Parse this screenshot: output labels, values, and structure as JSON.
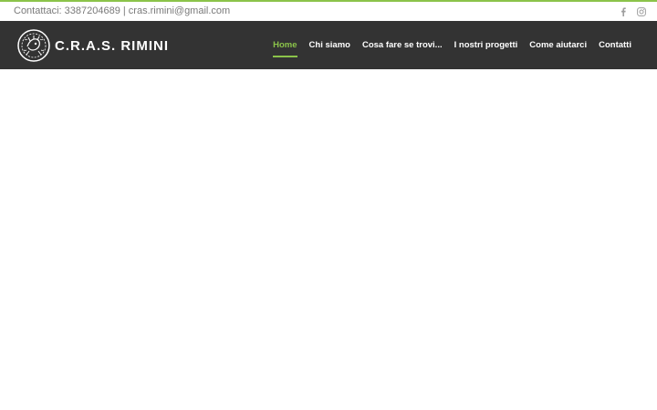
{
  "topbar": {
    "contact": "Contattaci: 3387204689 | cras.rimini@gmail.com",
    "accent_color": "#8bc34a",
    "social": [
      {
        "icon": "facebook-icon"
      },
      {
        "icon": "instagram-icon"
      }
    ]
  },
  "header": {
    "logo_text": "C.R.A.S. RIMINI",
    "background": "#333333",
    "nav": [
      {
        "label": "Home",
        "active": true
      },
      {
        "label": "Chi siamo",
        "active": false
      },
      {
        "label": "Cosa fare se trovi...",
        "active": false
      },
      {
        "label": "I nostri progetti",
        "active": false
      },
      {
        "label": "Come aiutarci",
        "active": false
      },
      {
        "label": "Contatti",
        "active": false
      }
    ]
  }
}
